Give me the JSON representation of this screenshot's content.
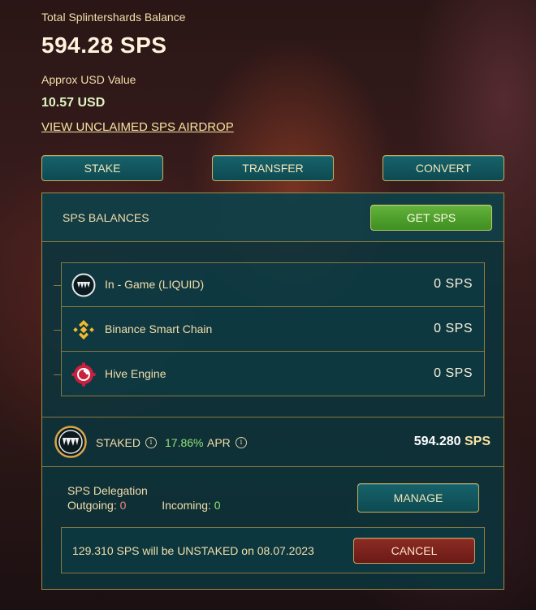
{
  "header": {
    "total_label": "Total Splintershards Balance",
    "total_value": "594.28 SPS",
    "usd_label": "Approx USD Value",
    "usd_value": "10.57 USD",
    "airdrop_link": "VIEW UNCLAIMED SPS AIRDROP"
  },
  "actions": {
    "stake": "STAKE",
    "transfer": "TRANSFER",
    "convert": "CONVERT"
  },
  "balances": {
    "title": "SPS BALANCES",
    "get_sps": "GET SPS",
    "rows": [
      {
        "name": "In - Game (LIQUID)",
        "amount": "0 SPS",
        "icon": "splinterlands-fang-icon"
      },
      {
        "name": "Binance Smart Chain",
        "amount": "0 SPS",
        "icon": "binance-icon"
      },
      {
        "name": "Hive Engine",
        "amount": "0 SPS",
        "icon": "hive-engine-icon"
      }
    ]
  },
  "staked": {
    "label": "STAKED",
    "apr_value": "17.86%",
    "apr_label": "APR",
    "amount": "594.280",
    "unit": "SPS"
  },
  "delegation": {
    "title": "SPS Delegation",
    "outgoing_label": "Outgoing:",
    "outgoing_value": "0",
    "incoming_label": "Incoming:",
    "incoming_value": "0",
    "manage": "MANAGE"
  },
  "unstake": {
    "text": "129.310 SPS will be UNSTAKED on 08.07.2023",
    "cancel": "CANCEL"
  },
  "colors": {
    "panel": "#0a343c",
    "border_gold": "#a38b46",
    "button_teal": "#17626a",
    "button_green": "#62b23a",
    "button_red": "#8c2b24",
    "apr_green": "#95e37a"
  }
}
